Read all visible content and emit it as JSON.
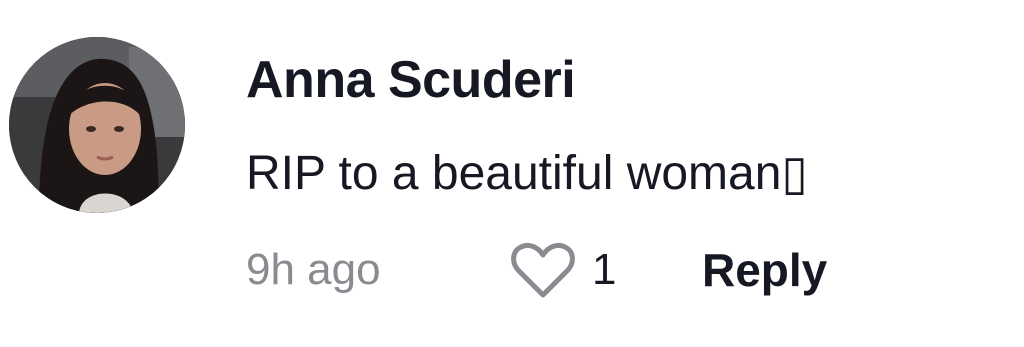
{
  "comment": {
    "author": "Anna Scuderi",
    "text": "RIP to a beautiful woman▯",
    "time": "9h ago",
    "like_count": "1",
    "reply_label": "Reply"
  },
  "colors": {
    "text_primary": "#161823",
    "text_secondary": "#8a8b91",
    "heart_stroke": "#8a8b91"
  },
  "icons": {
    "like": "heart-outline-icon"
  }
}
